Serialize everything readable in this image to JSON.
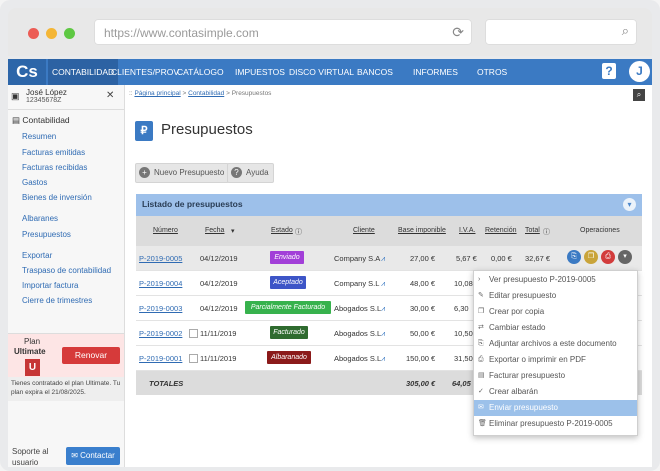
{
  "browser": {
    "url": "https://www.contasimple.com",
    "dot_colors": [
      "#ec5c55",
      "#f4b636",
      "#5ec843"
    ]
  },
  "nav": {
    "logo": "Cs",
    "items": [
      "CONTABILIDAD",
      "CLIENTES/PROV.",
      "CATÁLOGO",
      "IMPUESTOS",
      "DISCO VIRTUAL",
      "BANCOS",
      "INFORMES",
      "OTROS"
    ],
    "help": "?",
    "avatar": "J"
  },
  "user": {
    "name": "José López",
    "nif": "12345678Z"
  },
  "sidebar": {
    "section": "Contabilidad",
    "items": [
      "Resumen",
      "Facturas emitidas",
      "Facturas recibidas",
      "Gastos",
      "Bienes de inversión",
      "Albaranes",
      "Presupuestos",
      "Exportar",
      "Traspaso de contabilidad",
      "Importar factura",
      "Cierre de trimestres"
    ],
    "plan_label": "Plan",
    "plan_name": "Ultimate",
    "plan_badge": "U",
    "renew": "Renovar",
    "plan_note": "Tienes contratado el plan Ultimate. Tu plan expira el 21/08/2025.",
    "support": "Soporte al usuario",
    "contact": "Contactar"
  },
  "breadcrumb": {
    "prefix": "::",
    "home": "Página principal",
    "sep": ">",
    "section": "Contabilidad",
    "current": "Presupuestos"
  },
  "page": {
    "title": "Presupuestos",
    "new_button": "Nuevo Presupuesto",
    "help_button": "Ayuda",
    "list_title": "Listado de presupuestos"
  },
  "table": {
    "headers": [
      "Número",
      "Fecha",
      "Estado",
      "Cliente",
      "Base imponible",
      "I.V.A.",
      "Retención",
      "Total",
      "Operaciones"
    ],
    "rows": [
      {
        "numero": "P-2019-0005",
        "fecha": "04/12/2019",
        "estado": "Enviado",
        "estado_color": "#a23fd8",
        "cliente": "Company S.A",
        "base": "27,00 €",
        "iva": "5,67 €",
        "ret": "0,00 €",
        "total": "32,67 €"
      },
      {
        "numero": "P-2019-0004",
        "fecha": "04/12/2019",
        "estado": "Aceptado",
        "estado_color": "#3d55c7",
        "cliente": "Company S.L",
        "base": "48,00 €",
        "iva": "10,08",
        "ret": "",
        "total": ""
      },
      {
        "numero": "P-2019-0003",
        "fecha": "04/12/2019",
        "estado": "Parcialmente Facturado",
        "estado_color": "#37b24d",
        "cliente": "Abogados S.L",
        "base": "30,00 €",
        "iva": "6,30",
        "ret": "",
        "total": ""
      },
      {
        "numero": "P-2019-0002",
        "fecha": "11/11/2019",
        "estado": "Facturado",
        "estado_color": "#2f6b2f",
        "cliente": "Abogados S.L",
        "base": "50,00 €",
        "iva": "10,50",
        "ret": "",
        "total": ""
      },
      {
        "numero": "P-2019-0001",
        "fecha": "11/11/2019",
        "estado": "Albaranado",
        "estado_color": "#8b1a1a",
        "cliente": "Abogados S.L",
        "base": "150,00 €",
        "iva": "31,50",
        "ret": "",
        "total": ""
      }
    ],
    "totals_label": "TOTALES",
    "totals_base": "305,00 €",
    "totals_iva": "64,05"
  },
  "menu": {
    "items": [
      {
        "icon": "›",
        "label": "Ver presupuesto P-2019-0005"
      },
      {
        "icon": "✎",
        "label": "Editar presupuesto"
      },
      {
        "icon": "❐",
        "label": "Crear por copia"
      },
      {
        "icon": "⇄",
        "label": "Cambiar estado"
      },
      {
        "icon": "⎘",
        "label": "Adjuntar archivos a este documento"
      },
      {
        "icon": "⎙",
        "label": "Exportar o imprimir en PDF"
      },
      {
        "icon": "▤",
        "label": "Facturar presupuesto"
      },
      {
        "icon": "✓",
        "label": "Crear albarán"
      },
      {
        "icon": "✉",
        "label": "Enviar presupuesto"
      },
      {
        "icon": "🗑",
        "label": "Eliminar presupuesto P-2019-0005"
      }
    ],
    "highlighted_index": 8
  }
}
